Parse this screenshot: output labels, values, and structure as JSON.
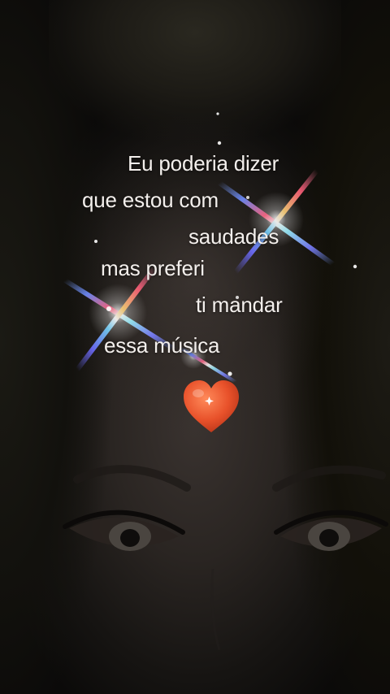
{
  "lyrics": [
    "Eu poderia dizer",
    "que estou com",
    "saudades",
    "mas preferi",
    "ti mandar",
    "essa música"
  ],
  "emoji": {
    "icon": "red-heart-icon",
    "color": "#e8512a"
  },
  "colors": {
    "text": "#f3efec",
    "background": "#1a1714"
  }
}
